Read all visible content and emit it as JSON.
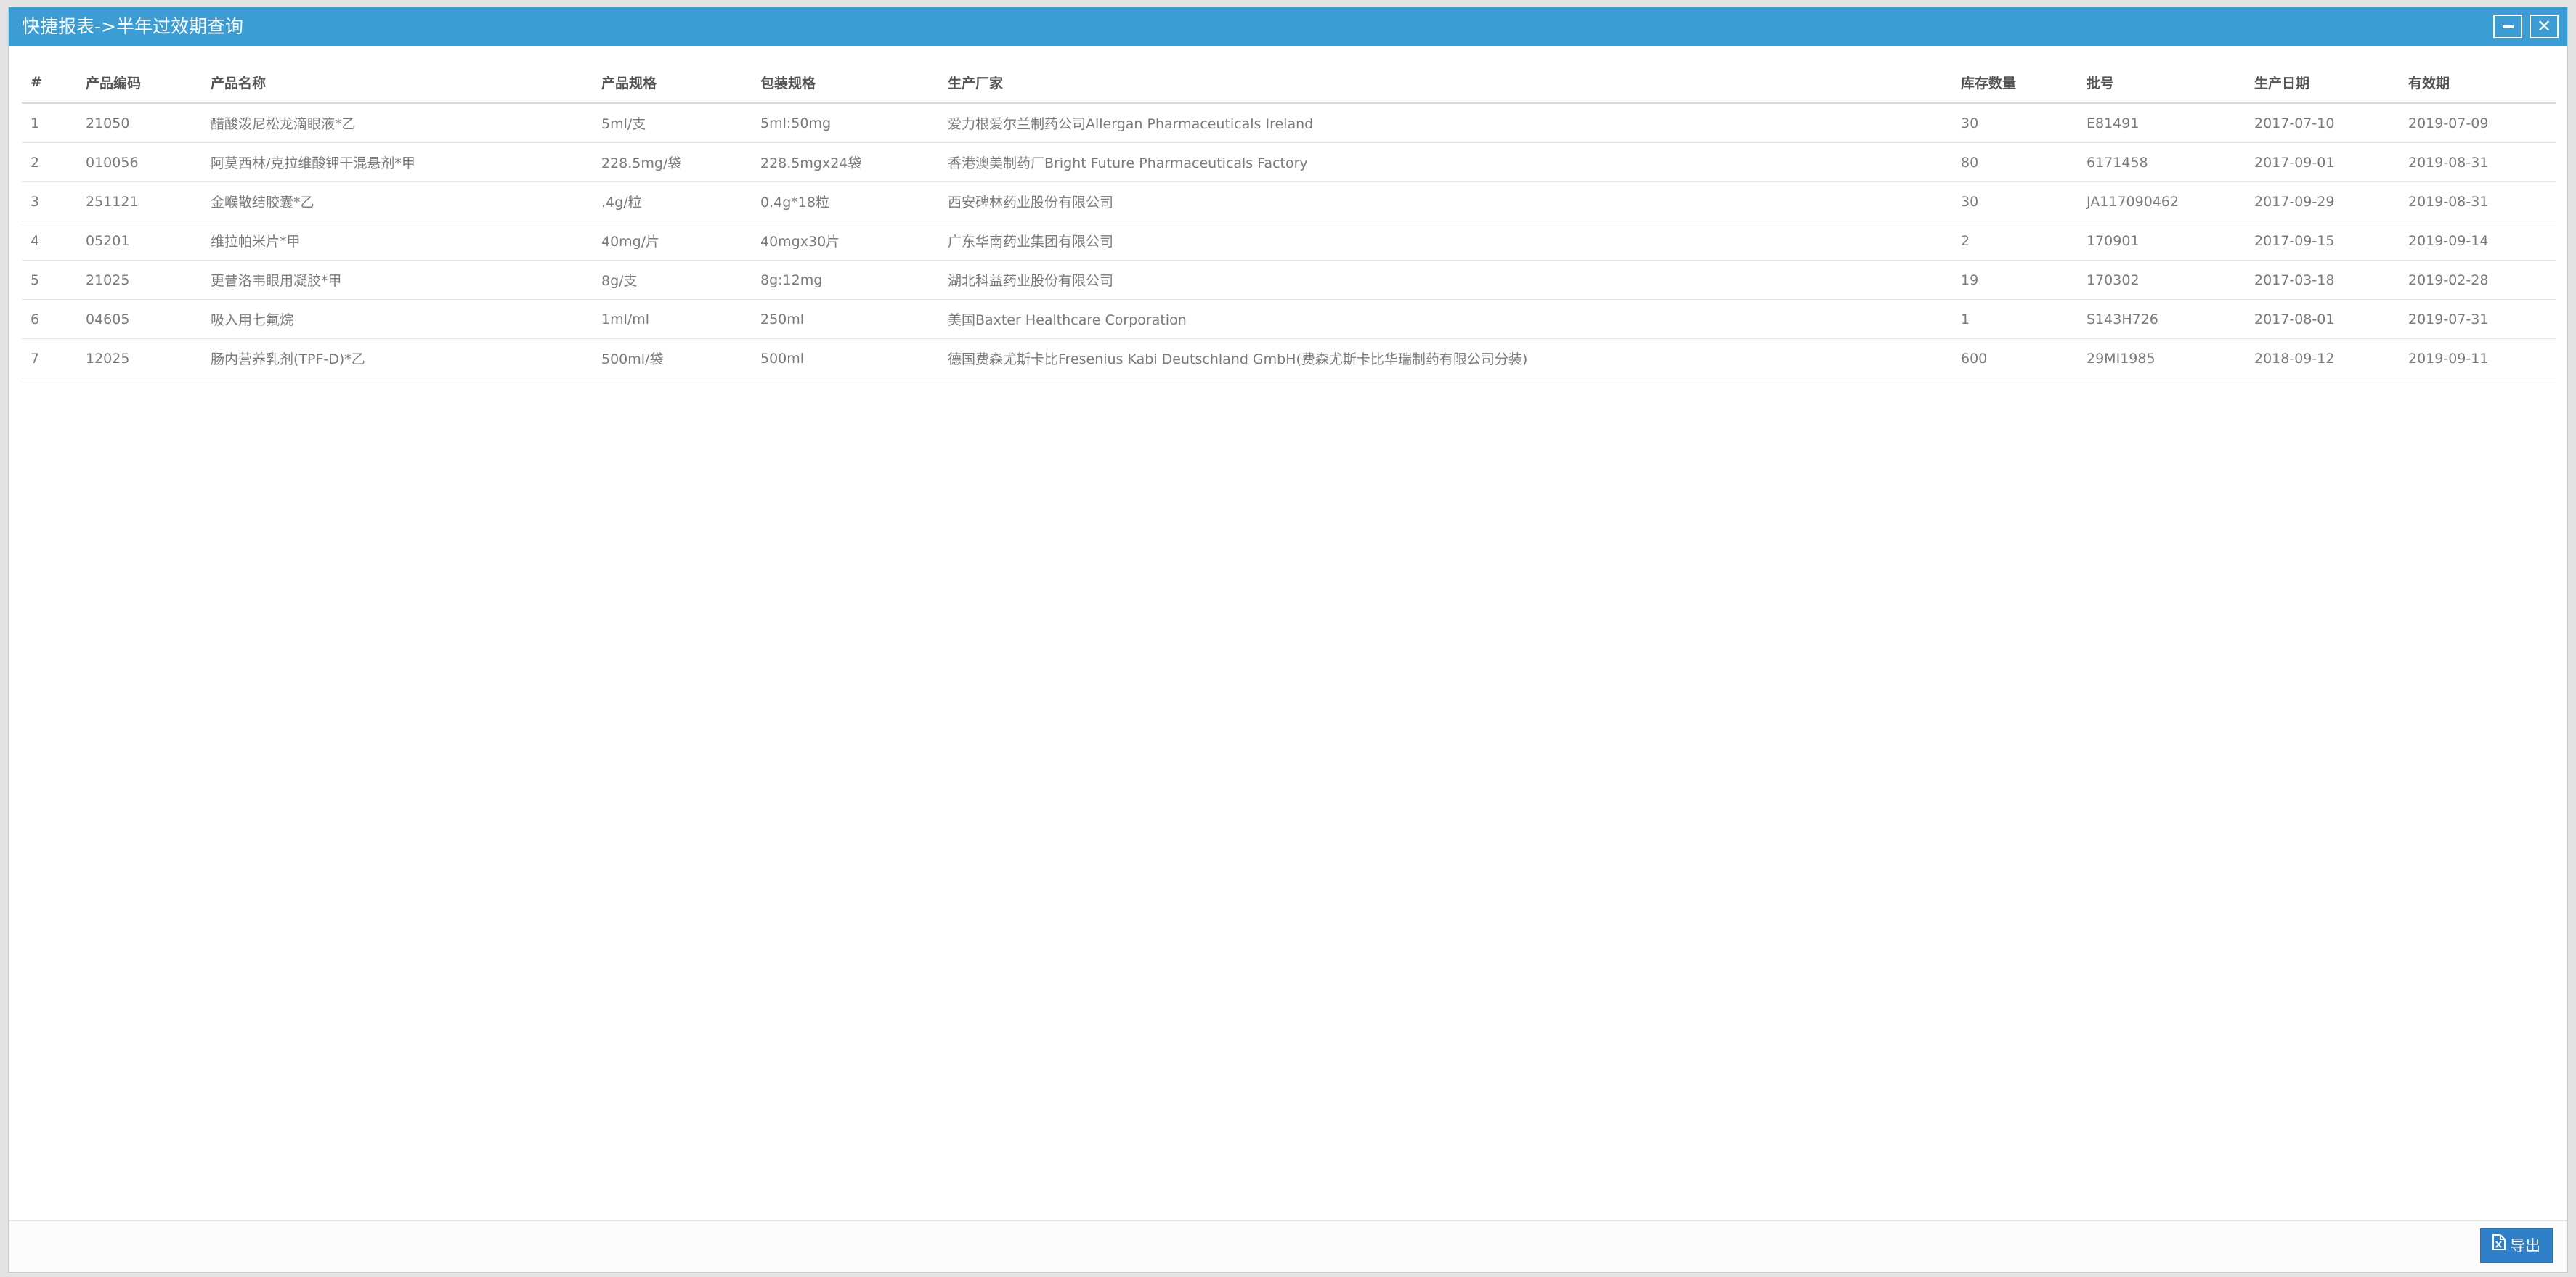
{
  "window": {
    "title": "快捷报表->半年过效期查询"
  },
  "table": {
    "columns": [
      "#",
      "产品编码",
      "产品名称",
      "产品规格",
      "包装规格",
      "生产厂家",
      "库存数量",
      "批号",
      "生产日期",
      "有效期"
    ],
    "rows": [
      [
        "1",
        "21050",
        "醋酸泼尼松龙滴眼液*乙",
        "5ml/支",
        "5ml:50mg",
        "爱力根爱尔兰制药公司Allergan Pharmaceuticals Ireland",
        "30",
        "E81491",
        "2017-07-10",
        "2019-07-09"
      ],
      [
        "2",
        "010056",
        "阿莫西林/克拉维酸钾干混悬剂*甲",
        "228.5mg/袋",
        "228.5mgx24袋",
        "香港澳美制药厂Bright Future Pharmaceuticals Factory",
        "80",
        "6171458",
        "2017-09-01",
        "2019-08-31"
      ],
      [
        "3",
        "251121",
        "金喉散结胶囊*乙",
        ".4g/粒",
        "0.4g*18粒",
        "西安碑林药业股份有限公司",
        "30",
        "JA117090462",
        "2017-09-29",
        "2019-08-31"
      ],
      [
        "4",
        "05201",
        "维拉帕米片*甲",
        "40mg/片",
        "40mgx30片",
        "广东华南药业集团有限公司",
        "2",
        "170901",
        "2017-09-15",
        "2019-09-14"
      ],
      [
        "5",
        "21025",
        "更昔洛韦眼用凝胶*甲",
        "8g/支",
        "8g:12mg",
        "湖北科益药业股份有限公司",
        "19",
        "170302",
        "2017-03-18",
        "2019-02-28"
      ],
      [
        "6",
        "04605",
        "吸入用七氟烷",
        "1ml/ml",
        "250ml",
        "美国Baxter Healthcare Corporation",
        "1",
        "S143H726",
        "2017-08-01",
        "2019-07-31"
      ],
      [
        "7",
        "12025",
        "肠内营养乳剂(TPF-D)*乙",
        "500ml/袋",
        "500ml",
        "德国费森尤斯卡比Fresenius Kabi Deutschland GmbH(费森尤斯卡比华瑞制药有限公司分装)",
        "600",
        "29MI1985",
        "2018-09-12",
        "2019-09-11"
      ]
    ]
  },
  "footer": {
    "export_label": "导出"
  },
  "icons": {
    "export": "file-excel-icon",
    "minimize": "minimize-icon",
    "close": "close-icon"
  },
  "colors": {
    "titlebar": "#3c9cd4",
    "export_button": "#2f7fc9"
  }
}
